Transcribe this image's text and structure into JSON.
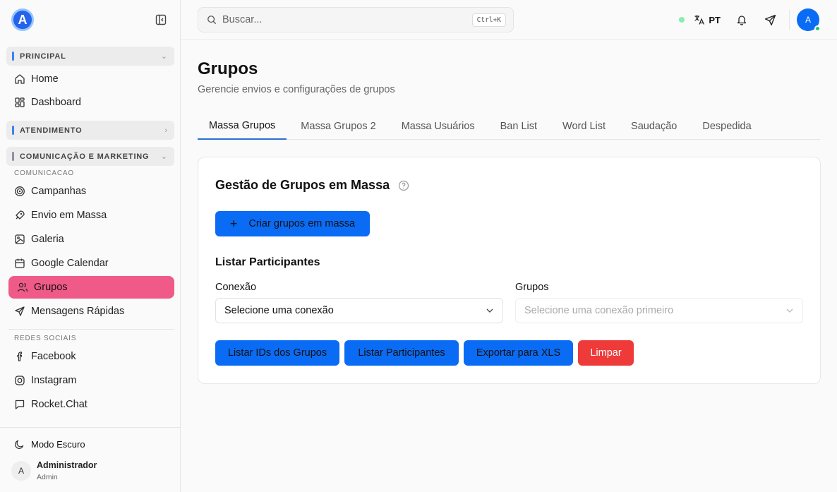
{
  "sidebar": {
    "sections": {
      "principal": "PRINCIPAL",
      "atendimento": "ATENDIMENTO",
      "comunicacao": "COMUNICAÇÃO E MARKETING"
    },
    "items": {
      "home": "Home",
      "dashboard": "Dashboard",
      "campanhas": "Campanhas",
      "envio": "Envio em Massa",
      "galeria": "Galeria",
      "calendar": "Google Calendar",
      "grupos": "Grupos",
      "mensagens": "Mensagens Rápidas",
      "facebook": "Facebook",
      "instagram": "Instagram",
      "rocket": "Rocket.Chat"
    },
    "sublabels": {
      "comunicacao": "COMUNICACAO",
      "redes": "REDES SOCIAIS"
    },
    "dark_mode": "Modo Escuro",
    "user": {
      "initial": "A",
      "name": "Administrador",
      "role": "Admin"
    }
  },
  "topbar": {
    "search_placeholder": "Buscar...",
    "shortcut": "Ctrl+K",
    "language": "PT",
    "avatar_initial": "A"
  },
  "page": {
    "title": "Grupos",
    "subtitle": "Gerencie envios e configurações de grupos",
    "tabs": [
      "Massa Grupos",
      "Massa Grupos 2",
      "Massa Usuários",
      "Ban List",
      "Word List",
      "Saudação",
      "Despedida"
    ],
    "card": {
      "title": "Gestão de Grupos em Massa",
      "create_button": "Criar grupos em massa",
      "list_title": "Listar Participantes",
      "conexao_label": "Conexão",
      "conexao_value": "Selecione uma conexão",
      "grupos_label": "Grupos",
      "grupos_value": "Selecione uma conexão primeiro",
      "buttons": {
        "list_ids": "Listar IDs dos Grupos",
        "list_participants": "Listar Participantes",
        "export": "Exportar para XLS",
        "clear": "Limpar"
      }
    }
  },
  "colors": {
    "accent": "#0a6cf5",
    "active_nav": "#f05a88",
    "danger": "#ef3a3a",
    "online": "#22c55e"
  }
}
